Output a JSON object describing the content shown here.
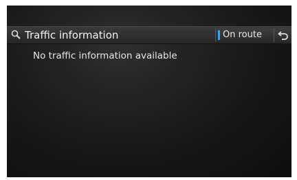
{
  "header": {
    "title": "Traffic information",
    "route_filter_label": "On route",
    "icons": {
      "search": "search-icon",
      "back": "back-arrow-icon"
    }
  },
  "content": {
    "message": "No traffic information available"
  },
  "colors": {
    "background": "#1c1c1c",
    "accent": "#2aa7ff",
    "text": "#f2f2f2"
  }
}
